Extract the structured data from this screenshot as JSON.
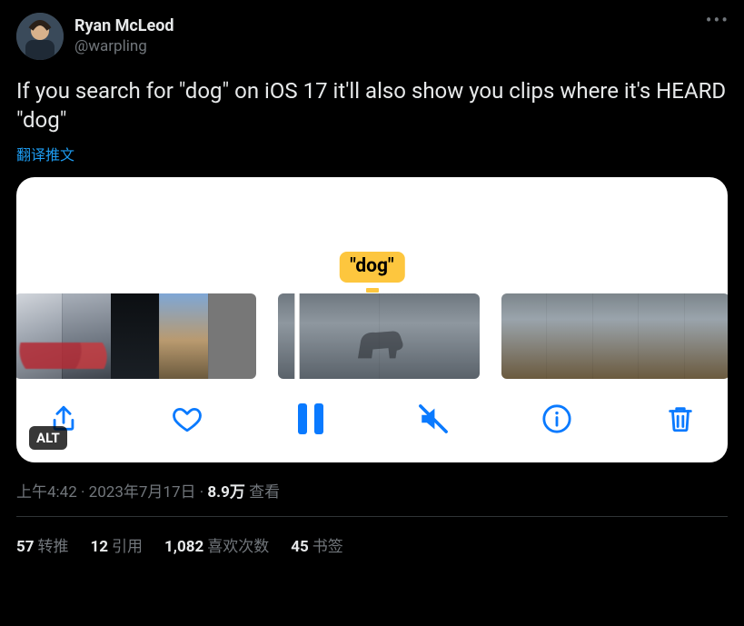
{
  "author": {
    "display_name": "Ryan McLeod",
    "handle": "@warpling"
  },
  "body_text": "If you search for \"dog\" on iOS 17 it'll also show you clips where it's HEARD \"dog\"",
  "translate_label": "翻译推文",
  "media": {
    "caption_bubble": "\"dog\"",
    "alt_badge": "ALT",
    "toolbar_icons": {
      "share": "share-icon",
      "like": "heart-icon",
      "pause": "pause-icon",
      "mute": "speaker-muted-icon",
      "info": "info-icon",
      "delete": "trash-icon"
    }
  },
  "meta": {
    "time": "上午4:42",
    "dot": " · ",
    "date": "2023年7月17日",
    "views_count": "8.9万",
    "views_label": " 查看"
  },
  "stats": {
    "retweets_count": "57",
    "retweets_label": "转推",
    "quotes_count": "12",
    "quotes_label": "引用",
    "likes_count": "1,082",
    "likes_label": "喜欢次数",
    "bookmarks_count": "45",
    "bookmarks_label": "书签"
  }
}
